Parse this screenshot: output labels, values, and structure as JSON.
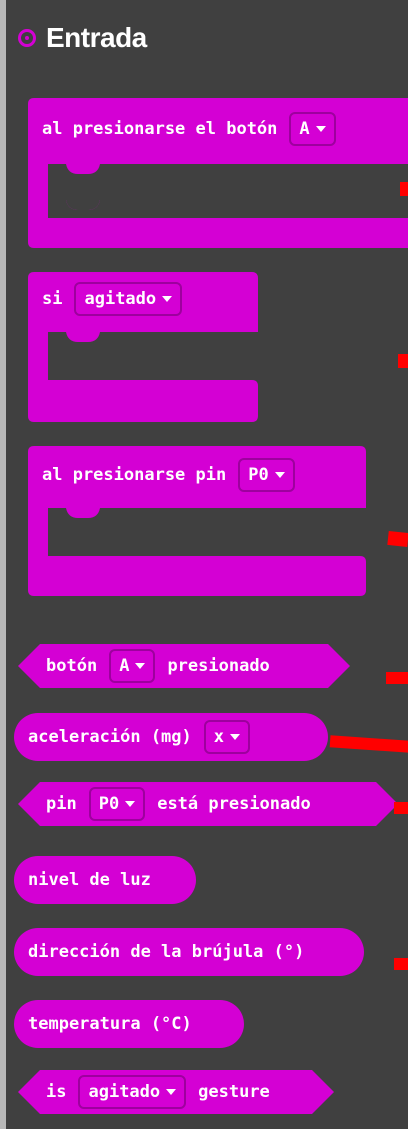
{
  "category": {
    "title": "Entrada",
    "color": "#d400d4",
    "icon": "radio-circle-icon"
  },
  "blocks": {
    "on_button": {
      "label": "al presionarse el botón",
      "dropdown": "A"
    },
    "if_gesture": {
      "label": "si",
      "dropdown": "agitado"
    },
    "on_pin": {
      "label": "al presionarse pin",
      "dropdown": "P0"
    },
    "button_pressed": {
      "label_pre": "botón",
      "dropdown": "A",
      "label_post": "presionado"
    },
    "acceleration": {
      "label": "aceleración (mg)",
      "dropdown": "x"
    },
    "pin_pressed": {
      "label_pre": "pin",
      "dropdown": "P0",
      "label_post": "está presionado"
    },
    "light_level": {
      "label": "nivel de luz"
    },
    "compass": {
      "label": "dirección de la brújula (°)"
    },
    "temperature": {
      "label": "temperatura (°C)"
    },
    "is_gesture": {
      "label_pre": "is",
      "dropdown": "agitado",
      "label_post": "gesture"
    }
  }
}
